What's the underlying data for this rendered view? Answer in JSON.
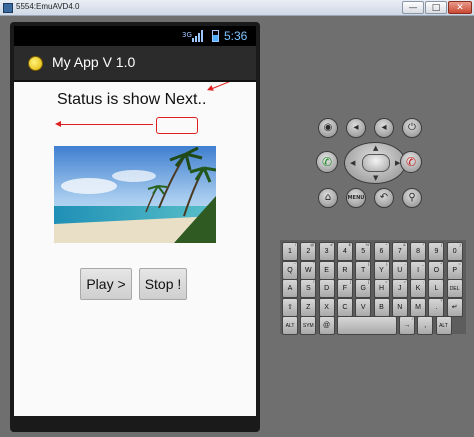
{
  "window": {
    "title": "5554:EmuAVD4.0",
    "min_glyph": "—",
    "max_glyph": "□",
    "close_glyph": "✕"
  },
  "statusbar": {
    "network": "3G",
    "time": "5:36"
  },
  "actionbar": {
    "title": "My App V 1.0"
  },
  "content": {
    "status_text": "Status is show Next..",
    "play_label": "Play >",
    "stop_label": "Stop !",
    "image_icon": "beach-photo"
  },
  "hardware": {
    "row1": [
      {
        "name": "camera-icon",
        "glyph": "◉"
      },
      {
        "name": "volume-down-icon",
        "glyph": "◂"
      },
      {
        "name": "volume-up-icon",
        "glyph": "◂"
      },
      {
        "name": "power-icon",
        "glyph": "⏻"
      }
    ],
    "call_glyph": "✆",
    "end_glyph": "✆",
    "row3": [
      {
        "name": "home-icon",
        "glyph": "⌂"
      },
      {
        "name": "menu-button",
        "glyph": "MENU"
      },
      {
        "name": "back-icon",
        "glyph": "↶"
      },
      {
        "name": "search-icon",
        "glyph": "⚲"
      }
    ]
  },
  "keyboard": {
    "row1": [
      {
        "k": "1",
        "s": "!"
      },
      {
        "k": "2",
        "s": "@"
      },
      {
        "k": "3",
        "s": "#"
      },
      {
        "k": "4",
        "s": "$"
      },
      {
        "k": "5",
        "s": "%"
      },
      {
        "k": "6",
        "s": "^"
      },
      {
        "k": "7",
        "s": "&"
      },
      {
        "k": "8",
        "s": "*"
      },
      {
        "k": "9",
        "s": "("
      },
      {
        "k": "0",
        "s": ")"
      }
    ],
    "row2": [
      {
        "k": "Q",
        "s": "~"
      },
      {
        "k": "W",
        "s": "\""
      },
      {
        "k": "E",
        "s": ""
      },
      {
        "k": "R",
        "s": ""
      },
      {
        "k": "T",
        "s": "{"
      },
      {
        "k": "Y",
        "s": "}"
      },
      {
        "k": "U",
        "s": "-"
      },
      {
        "k": "I",
        "s": "_"
      },
      {
        "k": "O",
        "s": "+"
      },
      {
        "k": "P",
        "s": "="
      }
    ],
    "row3": [
      {
        "k": "A",
        "s": ""
      },
      {
        "k": "S",
        "s": "\\"
      },
      {
        "k": "D",
        "s": ""
      },
      {
        "k": "F",
        "s": "["
      },
      {
        "k": "G",
        "s": "]"
      },
      {
        "k": "H",
        "s": "<"
      },
      {
        "k": "J",
        "s": ">"
      },
      {
        "k": "K",
        "s": ";"
      },
      {
        "k": "L",
        "s": ":"
      },
      {
        "k": "DEL",
        "s": ""
      }
    ],
    "row4": [
      {
        "k": "⇧",
        "s": ""
      },
      {
        "k": "Z",
        "s": ""
      },
      {
        "k": "X",
        "s": ""
      },
      {
        "k": "C",
        "s": ""
      },
      {
        "k": "V",
        "s": ""
      },
      {
        "k": "B",
        "s": ""
      },
      {
        "k": "N",
        "s": ""
      },
      {
        "k": "M",
        "s": ""
      },
      {
        "k": ".",
        "s": "?"
      },
      {
        "k": "↵",
        "s": ""
      }
    ],
    "row5": [
      {
        "k": "ALT",
        "s": ""
      },
      {
        "k": "SYM",
        "s": ""
      },
      {
        "k": "@",
        "s": ""
      },
      {
        "k": "",
        "s": ""
      },
      {
        "k": "→",
        "s": "/"
      },
      {
        "k": ",",
        "s": ""
      },
      {
        "k": "ALT",
        "s": ""
      }
    ]
  }
}
